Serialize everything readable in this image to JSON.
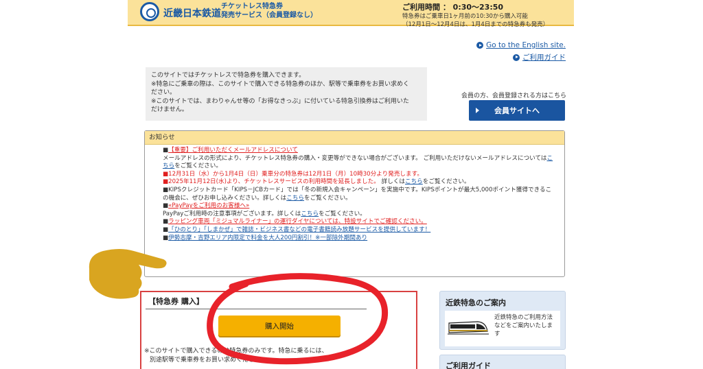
{
  "header": {
    "brand": "近畿日本鉄道",
    "service_line1": "チケットレス特急券",
    "service_line2": "発売サービス（会員登録なし）",
    "hours_title": "ご利用時間 ： 0:30〜23:50",
    "hours_note1": "特急券はご乗車日1ヶ月前の10:30から購入可能",
    "hours_note2": "（12月1日〜12月4日は、1月4日までの特急券も発売）"
  },
  "links": {
    "english": "Go to the English site.",
    "guide": "ご利用ガイド"
  },
  "intro": {
    "lines": [
      "このサイトではチケットレスで特急券を購入できます。",
      "※特急にご乗車の際は、このサイトで購入できる特急券のほか、駅等で乗車券をお買い求めく",
      "ださい。",
      "※このサイトでは、まわりゃんせ等の「お得なきっぷ」に付いている特急引換券はご利用いた",
      "だけません。"
    ]
  },
  "member": {
    "note": "会員の方、会員登録される方はこちら",
    "button": "会員サイトへ"
  },
  "notice": {
    "title": "お知らせ",
    "item1_marker": "■",
    "item1_title": "【重要】ご利用いただくメールアドレスについて",
    "item1_text": "メールアドレスの形式により、チケットレス特急券の購入・変更等ができない場合がございます。 ご利用いただけないメールアドレスについては",
    "item1_link": "こちら",
    "item1_tail": "をご覧ください。",
    "item2": "■12月31日（水）から1月4日（日）乗車分の特急券は12月1日（月）10時30分より発売します。",
    "item3_red": "■2025年11月12日(水)より、チケットレスサービスの利用時間を延長しました。",
    "item3_text": " 詳しくは",
    "item3_link": "こちら",
    "item3_tail": "をご覧ください。",
    "item4_text": "■KIPSクレジットカード「KIPS－JCBカード」では「冬の新規入会キャンペーン」を実施中です。KIPSポイントが最大5,000ポイント獲得できるこの機会に、ぜひお申し込みください。詳しくは",
    "item4_link": "こちら",
    "item4_tail": "をご覧ください。",
    "item5_marker": "■",
    "item5_title": "«PayPayをご利用のお客様へ»",
    "item5_text": "PayPayご利用時の注意事項がございます。詳しくは",
    "item5_link": "こちら",
    "item5_tail": "をご覧ください。",
    "item6_marker": "■",
    "item6_link": "ラッピング車両「ミジュマルライナー」の運行ダイヤについては、特設サイトでご確認ください。",
    "item7_marker": "■",
    "item7_link": "「ひのとり」「しまかぜ」で雑誌・ビジネス書などの電子書籍読み放題サービスを提供しています！",
    "item8_marker": "■",
    "item8_link": "伊勢志摩・吉野エリア内限定で料金を大人200円割引！※一部除外期間あり"
  },
  "purchase": {
    "title": "【特急券 購入】",
    "button": "購入開始",
    "note1": "※このサイトで購入できるのは特急券のみです。特急に乗るには、",
    "note2": "別途駅等で乗車券をお買い求めください。"
  },
  "sidebar": {
    "guide_title": "近鉄特急のご案内",
    "guide_desc": "近鉄特急のご利用方法などをご案内いたします",
    "guide2_title": "ご利用ガイド"
  },
  "colors": {
    "header_bg": "#fbe29a",
    "brand_blue": "#1b5aa5",
    "alert_red": "#e02020",
    "button_orange": "#f5b000",
    "annotation_red": "#e8222a",
    "pointer_gold": "#d9a520"
  }
}
